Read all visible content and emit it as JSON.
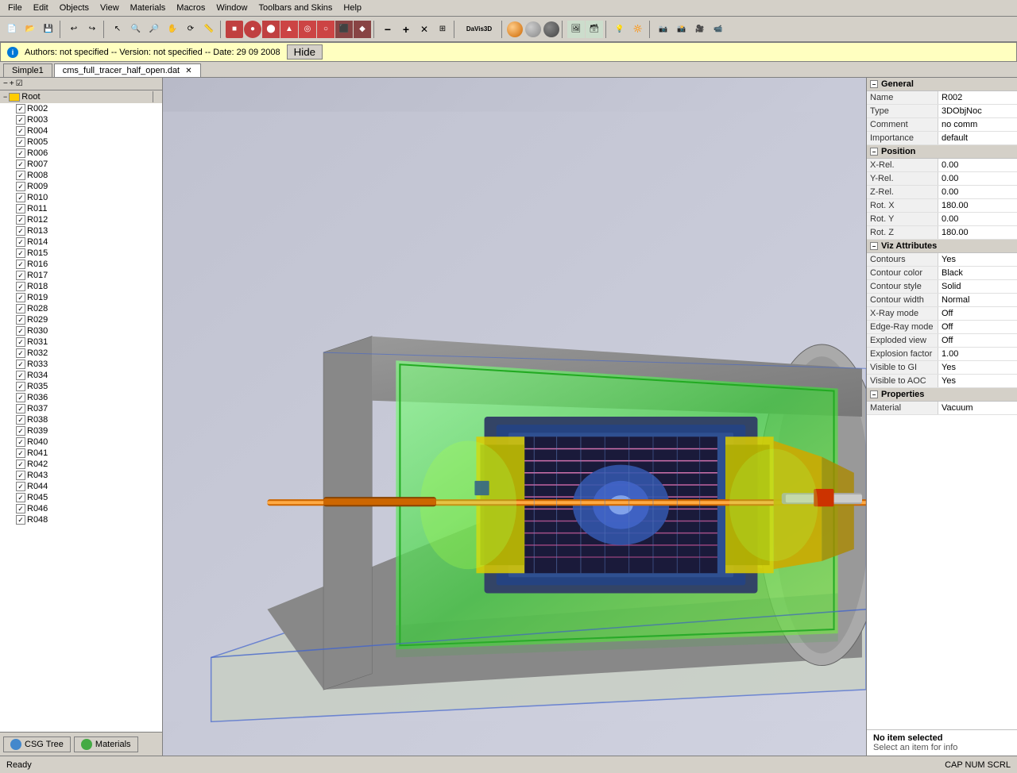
{
  "app": {
    "title": "DaVis3D"
  },
  "menubar": {
    "items": [
      "File",
      "Edit",
      "Objects",
      "View",
      "Materials",
      "Macros",
      "Window",
      "Toolbars and Skins",
      "Help"
    ]
  },
  "infobar": {
    "text": "Authors: not specified  --  Version: not specified  --  Date: 29 09 2008",
    "hide_label": "Hide"
  },
  "tabs": [
    {
      "label": "Simple1",
      "active": false,
      "closeable": false
    },
    {
      "label": "cms_full_tracer_half_open.dat",
      "active": true,
      "closeable": true
    }
  ],
  "tree": {
    "root_label": "Root",
    "items": [
      "R002",
      "R003",
      "R004",
      "R005",
      "R006",
      "R007",
      "R008",
      "R009",
      "R010",
      "R011",
      "R012",
      "R013",
      "R014",
      "R015",
      "R016",
      "R017",
      "R018",
      "R019",
      "R028",
      "R029",
      "R030",
      "R031",
      "R032",
      "R033",
      "R034",
      "R035",
      "R036",
      "R037",
      "R038",
      "R039",
      "R040",
      "R041",
      "R042",
      "R043",
      "R044",
      "R045",
      "R046",
      "R048"
    ]
  },
  "bottom_tabs": [
    {
      "label": "CSG Tree",
      "icon_color": "#4488cc"
    },
    {
      "label": "Materials",
      "icon_color": "#44aa44"
    }
  ],
  "properties": {
    "general": {
      "section": "General",
      "rows": [
        {
          "key": "Name",
          "value": "R002"
        },
        {
          "key": "Type",
          "value": "3DObjNoc"
        },
        {
          "key": "Comment",
          "value": "no comm"
        },
        {
          "key": "Importance",
          "value": "default"
        }
      ]
    },
    "position": {
      "section": "Position",
      "rows": [
        {
          "key": "X-Rel.",
          "value": "0.00"
        },
        {
          "key": "Y-Rel.",
          "value": "0.00"
        },
        {
          "key": "Z-Rel.",
          "value": "0.00"
        },
        {
          "key": "Rot. X",
          "value": "180.00"
        },
        {
          "key": "Rot. Y",
          "value": "0.00"
        },
        {
          "key": "Rot. Z",
          "value": "180.00"
        }
      ]
    },
    "viz_attributes": {
      "section": "Viz Attributes",
      "rows": [
        {
          "key": "Contours",
          "value": "Yes"
        },
        {
          "key": "Contour color",
          "value": "Black"
        },
        {
          "key": "Contour style",
          "value": "Solid"
        },
        {
          "key": "Contour width",
          "value": "Normal"
        },
        {
          "key": "X-Ray mode",
          "value": "Off"
        },
        {
          "key": "Edge-Ray mode",
          "value": "Off"
        },
        {
          "key": "Exploded view",
          "value": "Off"
        },
        {
          "key": "Explosion factor",
          "value": "1.00"
        },
        {
          "key": "Visible to GI",
          "value": "Yes"
        },
        {
          "key": "Visible to AOC",
          "value": "Yes"
        }
      ]
    },
    "properties_section": {
      "section": "Properties",
      "rows": [
        {
          "key": "Material",
          "value": "Vacuum"
        }
      ]
    }
  },
  "bottom_right": {
    "line1": "No item selected",
    "line2": "Select an item for info"
  },
  "statusbar": {
    "left": "Ready",
    "right": "CAP  NUM  SCRL"
  }
}
